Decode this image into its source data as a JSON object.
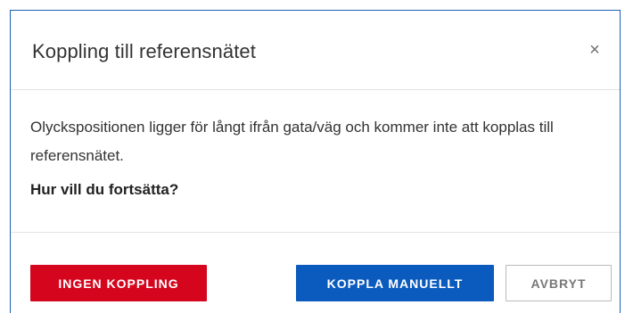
{
  "dialog": {
    "title": "Koppling till referensnätet",
    "close_symbol": "×",
    "message": "Olyckspositionen ligger för långt ifrån gata/väg och kommer inte att kopplas till referensnätet.",
    "question": "Hur vill du fortsätta?"
  },
  "buttons": {
    "no_connection": "INGEN KOPPLING",
    "connect_manually": "KOPPLA MANUELLT",
    "cancel": "AVBRYT"
  },
  "colors": {
    "danger": "#d4051d",
    "primary": "#0b5bbf",
    "modal_border": "#1a5fb4"
  },
  "icons": {
    "close": "close-icon"
  }
}
